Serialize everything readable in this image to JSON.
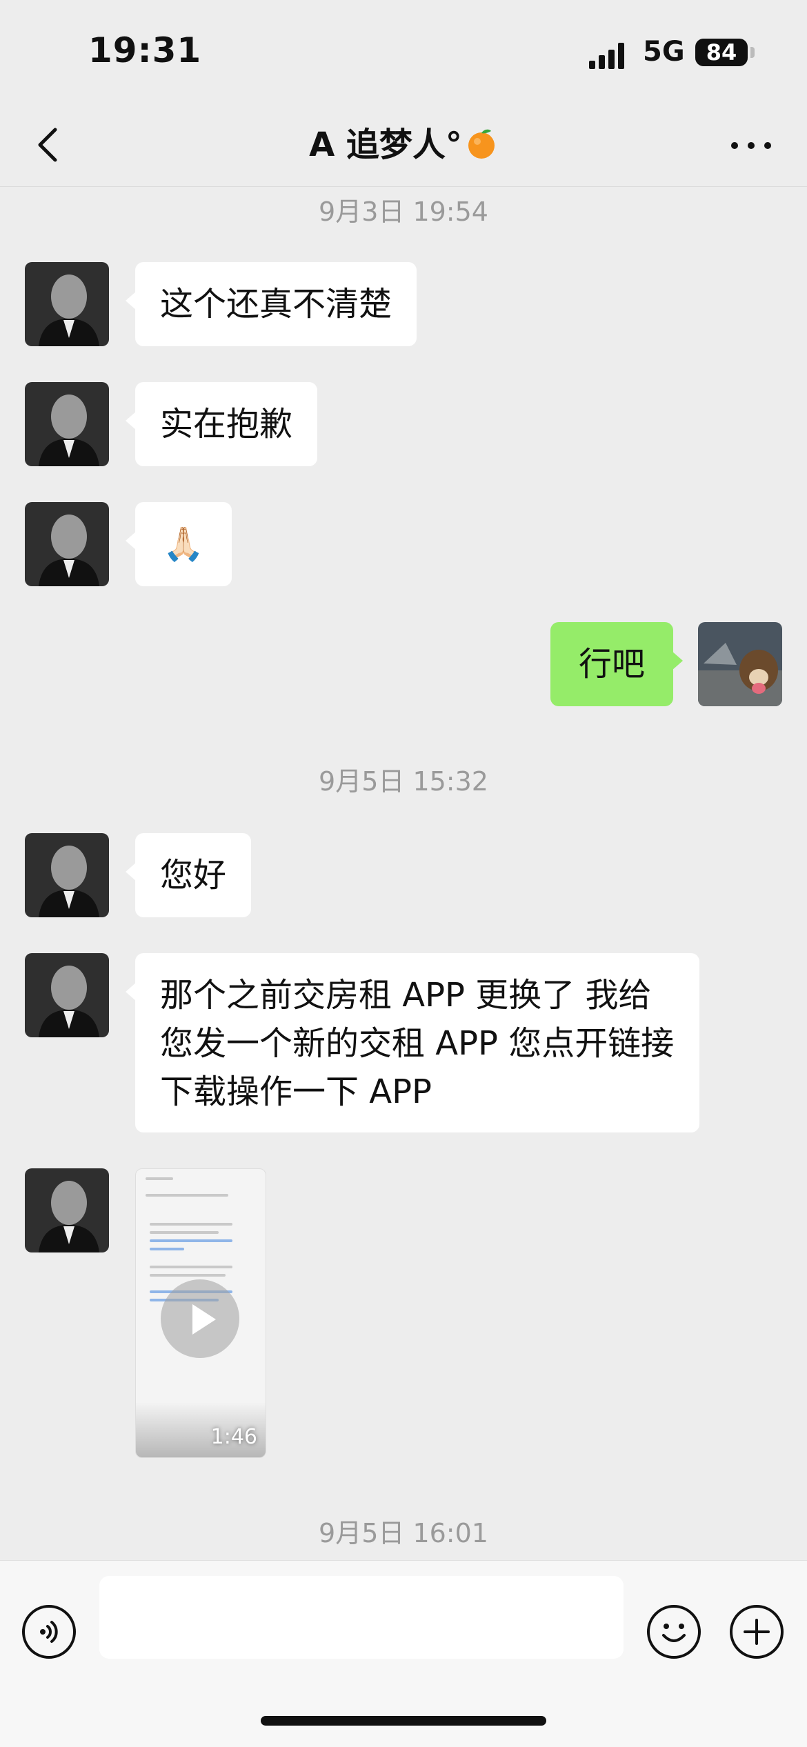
{
  "status_bar": {
    "time": "19:31",
    "network": "5G",
    "battery": "84"
  },
  "header": {
    "title": "A 追梦人°",
    "back_icon": "chevron-left-icon",
    "more_icon": "more-dots-icon",
    "title_emoji_icon": "orange-icon"
  },
  "timestamps": [
    "9月3日 19:54",
    "9月5日 15:32",
    "9月5日 16:01"
  ],
  "messages": {
    "m1": "这个还真不清楚",
    "m2": "实在抱歉",
    "m3": "🙏🏻",
    "m4": "行吧",
    "m5": "您好",
    "m6": "那个之前交房租 APP 更换了 我给您发一个新的交租 APP 您点开链接下载操作一下 APP"
  },
  "video": {
    "duration": "1:46"
  },
  "input_bar": {
    "voice_icon": "voice-icon",
    "emoji_icon": "emoji-icon",
    "add_icon": "plus-icon",
    "placeholder": ""
  },
  "colors": {
    "background": "#ededed",
    "my_bubble": "#95ec69",
    "their_bubble": "#ffffff",
    "timestamp": "#9a9a9a"
  }
}
